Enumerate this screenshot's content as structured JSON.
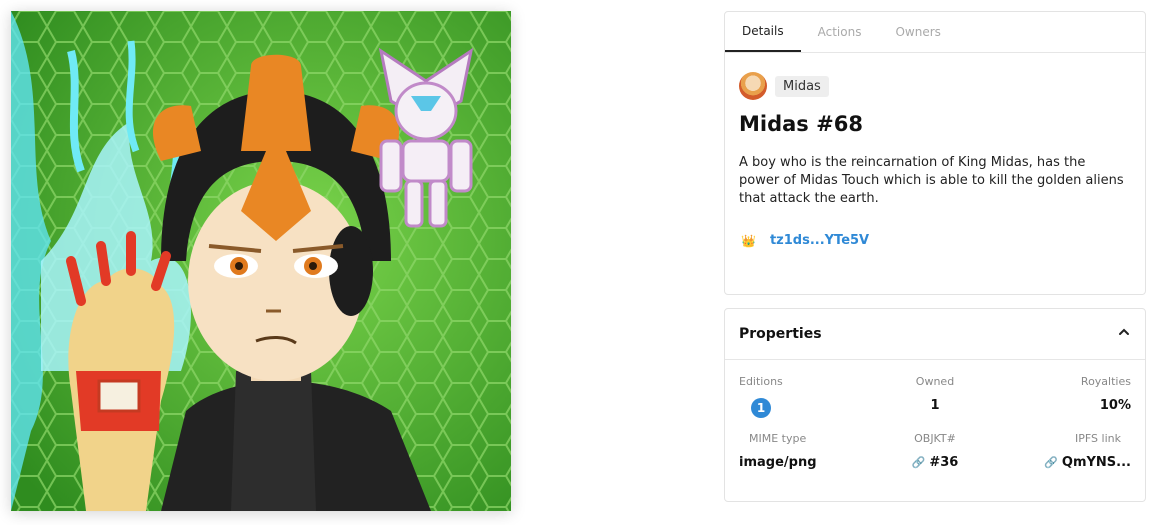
{
  "tabs": [
    {
      "label": "Details"
    },
    {
      "label": "Actions"
    },
    {
      "label": "Owners"
    }
  ],
  "creator": {
    "name": "Midas"
  },
  "token": {
    "title": "Midas #68",
    "description": "A boy who is the reincarnation of King Midas, has the power of Midas Touch which is able to kill the golden aliens that attack the earth.",
    "owner_address": "tz1ds...YTe5V"
  },
  "properties": {
    "title": "Properties",
    "editions_label": "Editions",
    "editions_value": "1",
    "owned_label": "Owned",
    "owned_value": "1",
    "royalties_label": "Royalties",
    "royalties_value": "10%",
    "mime_label": "MIME type",
    "mime_value": "image/png",
    "objkt_label": "OBJKT#",
    "objkt_value": "#36",
    "ipfs_label": "IPFS link",
    "ipfs_value": "QmYNS..."
  },
  "colors": {
    "accent": "#2f89d6",
    "art_background": "#3fa52a"
  },
  "icons": {
    "chevron": "chevron-up-icon",
    "link": "link-icon",
    "owner": "crown-icon"
  }
}
